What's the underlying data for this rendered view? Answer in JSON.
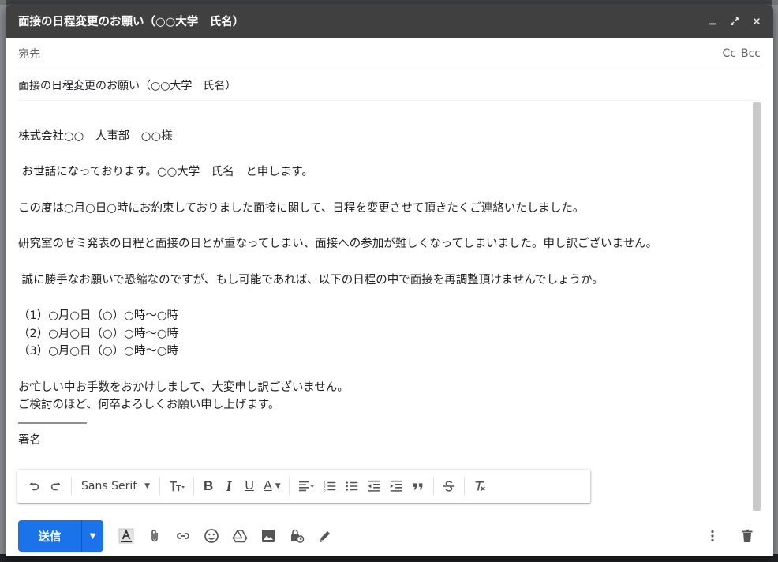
{
  "window": {
    "title": "面接の日程変更のお願い（○○大学　氏名）"
  },
  "recipients": {
    "to_label": "宛先",
    "cc_label": "Cc",
    "bcc_label": "Bcc"
  },
  "subject": "面接の日程変更のお願い（○○大学　氏名）",
  "body": {
    "greeting": "株式会社○○　人事部　○○様",
    "intro": " お世話になっております。○○大学　氏名　と申します。",
    "para1": "この度は○月○日○時にお約束しておりました面接に関して、日程を変更させて頂きたくご連絡いたしました。",
    "para2": "研究室のゼミ発表の日程と面接の日とが重なってしまい、面接への参加が難しくなってしまいました。申し訳ございません。",
    "para3": " 誠に勝手なお願いで恐縮なのですが、もし可能であれば、以下の日程の中で面接を再調整頂けませんでしょうか。",
    "options": [
      "（1）○月○日（○）○時～○時",
      "（2）○月○日（○）○時～○時",
      "（3）○月○日（○）○時～○時"
    ],
    "closing1": "お忙しい中お手数をおかけしまして、大変申し訳ございません。",
    "closing2": "ご検討のほど、何卒よろしくお願い申し上げます。",
    "separator": "――――――",
    "signature": "署名"
  },
  "format_bar": {
    "font_name": "Sans Serif",
    "bold": "B",
    "italic": "I",
    "underline": "U",
    "text_color": "A"
  },
  "actions": {
    "send_label": "送信"
  },
  "colors": {
    "titlebar": "#404040",
    "send": "#1a73e8"
  }
}
